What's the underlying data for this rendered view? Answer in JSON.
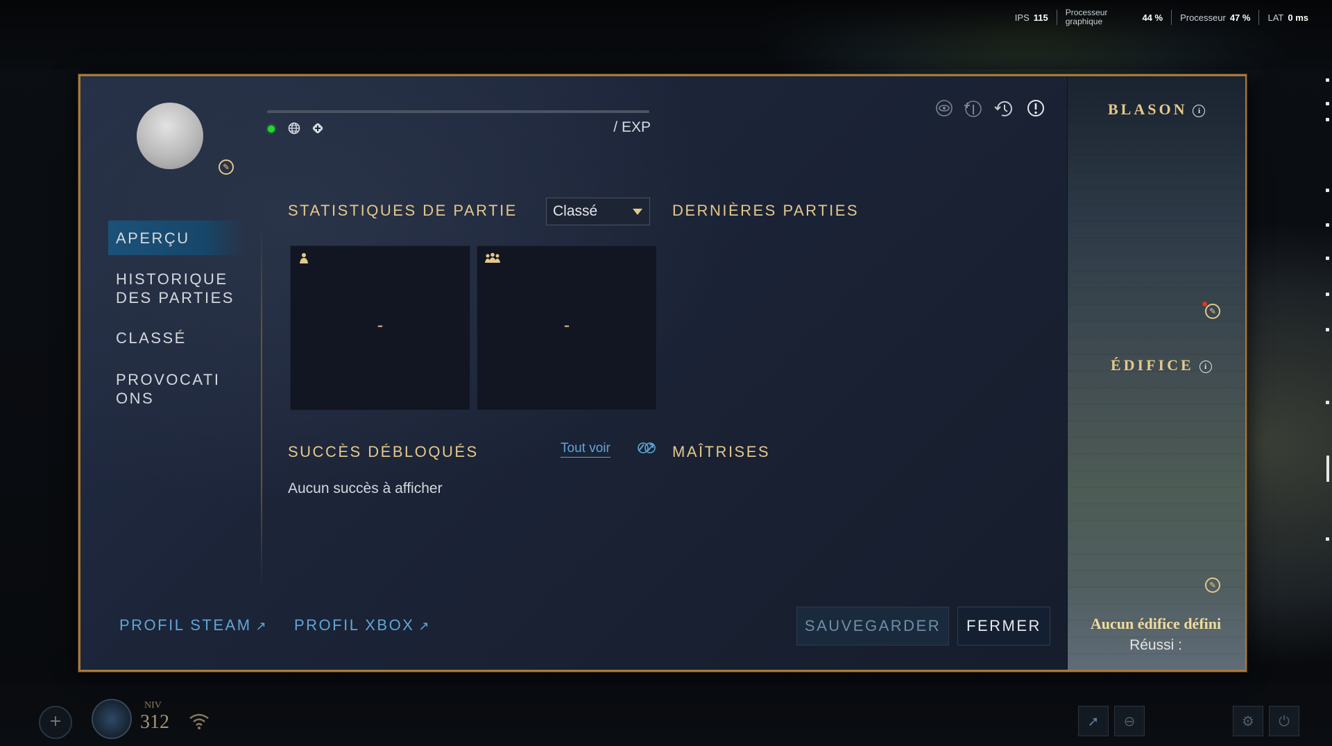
{
  "hud": {
    "fps_label": "IPS",
    "fps_value": "115",
    "gpu_label_1": "Processeur",
    "gpu_label_2": "graphique",
    "gpu_value": "44 %",
    "cpu_label": "Processeur",
    "cpu_value": "47 %",
    "lat_label": "LAT",
    "lat_value": "0 ms"
  },
  "profile": {
    "exp_text": "/ EXP",
    "status_color": "#23d82e",
    "icons": [
      "globe-icon",
      "controller-icon"
    ],
    "top_icons": [
      "eye-icon",
      "add-friend-icon",
      "history-icon",
      "report-icon"
    ]
  },
  "nav": {
    "items": [
      {
        "label": "APERÇU",
        "active": true
      },
      {
        "label": "HISTORIQUE\nDES PARTIES",
        "active": false
      },
      {
        "label": "CLASSÉ",
        "active": false
      },
      {
        "label": "PROVOCATI\nONS",
        "active": false
      }
    ]
  },
  "stats": {
    "heading": "STATISTIQUES DE PARTIE",
    "mode_selected": "Classé",
    "solo_value": "-",
    "team_value": "-"
  },
  "recent": {
    "heading": "DERNIÈRES PARTIES"
  },
  "achievements": {
    "heading": "SUCCÈS DÉBLOQUÉS",
    "see_all": "Tout voir",
    "empty": "Aucun succès à afficher"
  },
  "masteries": {
    "heading": "MAÎTRISES"
  },
  "footer": {
    "steam": "PROFIL STEAM",
    "xbox": "PROFIL XBOX",
    "save": "SAUVEGARDER",
    "close": "FERMER"
  },
  "side": {
    "blason": "BLASON",
    "edifice": "ÉDIFICE",
    "edifice_name": "Aucun édifice défini",
    "reussi": "Réussi :"
  },
  "bottom": {
    "niv_label": "NIV",
    "level": "312"
  },
  "colors": {
    "accent_gold": "#e5c98a",
    "link_blue": "#5fa7d6",
    "frame_border": "#a77a3a"
  }
}
